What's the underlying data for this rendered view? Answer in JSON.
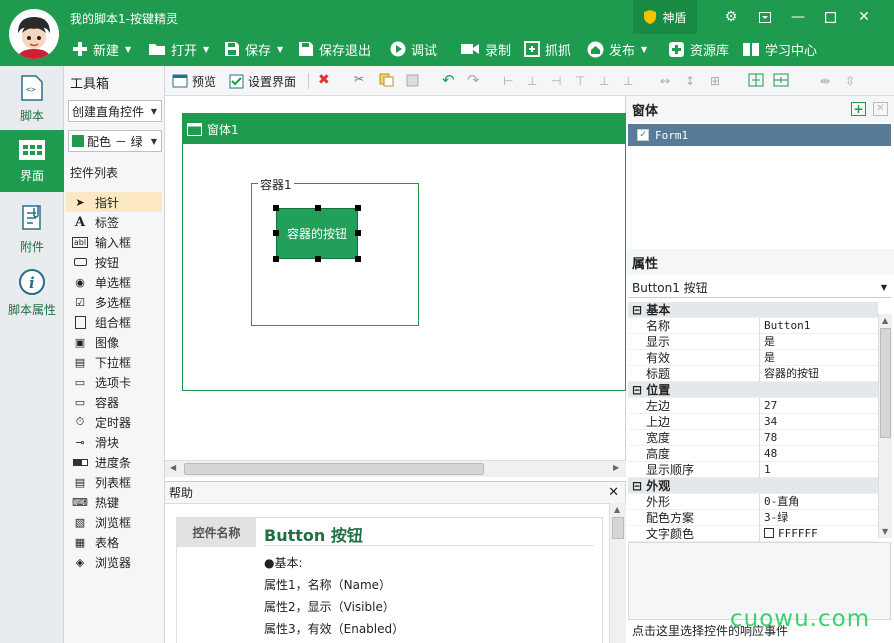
{
  "window": {
    "title": "我的脚本1-按键精灵",
    "shield_label": "神盾"
  },
  "menubar": [
    {
      "label": "新建",
      "icon": "plus-icon",
      "caret": true
    },
    {
      "label": "打开",
      "icon": "folder-icon",
      "caret": true
    },
    {
      "label": "保存",
      "icon": "floppy-icon",
      "caret": true
    },
    {
      "label": "保存退出",
      "icon": "floppy-exit-icon",
      "caret": false
    },
    {
      "label": "调试",
      "icon": "play-icon",
      "caret": false
    },
    {
      "label": "录制",
      "icon": "camera-icon",
      "caret": false
    },
    {
      "label": "抓抓",
      "icon": "grab-icon",
      "caret": false
    },
    {
      "label": "发布",
      "icon": "home-icon",
      "caret": true
    },
    {
      "label": "资源库",
      "icon": "plus-box-icon",
      "caret": false
    },
    {
      "label": "学习中心",
      "icon": "book-icon",
      "caret": false
    }
  ],
  "leftnav": [
    {
      "label": "脚本",
      "icon": "code-file-icon"
    },
    {
      "label": "界面",
      "icon": "grid-window-icon",
      "active": true
    },
    {
      "label": "附件",
      "icon": "attachment-icon"
    },
    {
      "label": "脚本属性",
      "icon": "info-icon"
    }
  ],
  "toolbox": {
    "title": "工具箱",
    "mode_select": "创建直角控件",
    "color_select": "配色 － 绿",
    "list_title": "控件列表",
    "items": [
      "指针",
      "标签",
      "输入框",
      "按钮",
      "单选框",
      "多选框",
      "组合框",
      "图像",
      "下拉框",
      "选项卡",
      "容器",
      "定时器",
      "滑块",
      "进度条",
      "列表框",
      "热键",
      "浏览框",
      "表格",
      "浏览器"
    ],
    "selected": "指针"
  },
  "toolbar2": {
    "preview": "预览",
    "setup": "设置界面"
  },
  "designer": {
    "form_title": "窗体1",
    "container_label": "容器1",
    "button_label": "容器的按钮"
  },
  "help": {
    "title": "帮助",
    "label": "控件名称",
    "heading": "Button 按钮",
    "lines": [
      "●基本:",
      "属性1，名称（Name）",
      "属性2，显示（Visible）",
      "属性3，有效（Enabled）"
    ]
  },
  "forms_panel": {
    "title": "窗体",
    "item": "Form1"
  },
  "properties": {
    "title": "属性",
    "selector": "Button1 按钮",
    "groups": [
      {
        "name": "基本",
        "rows": [
          [
            "名称",
            "Button1"
          ],
          [
            "显示",
            "是"
          ],
          [
            "有效",
            "是"
          ],
          [
            "标题",
            "容器的按钮"
          ]
        ]
      },
      {
        "name": "位置",
        "rows": [
          [
            "左边",
            "27"
          ],
          [
            "上边",
            "34"
          ],
          [
            "宽度",
            "78"
          ],
          [
            "高度",
            "48"
          ],
          [
            "显示顺序",
            "1"
          ]
        ]
      },
      {
        "name": "外观",
        "rows": [
          [
            "外形",
            "0-直角"
          ],
          [
            "配色方案",
            "3-绿"
          ],
          [
            "文字颜色",
            "FFFFFF"
          ]
        ]
      }
    ]
  },
  "event_hint": "点击这里选择控件的响应事件",
  "watermark": "cuowu.com",
  "colors": {
    "brand_green": "#1f9b4f",
    "selection_blue": "#587c98"
  }
}
